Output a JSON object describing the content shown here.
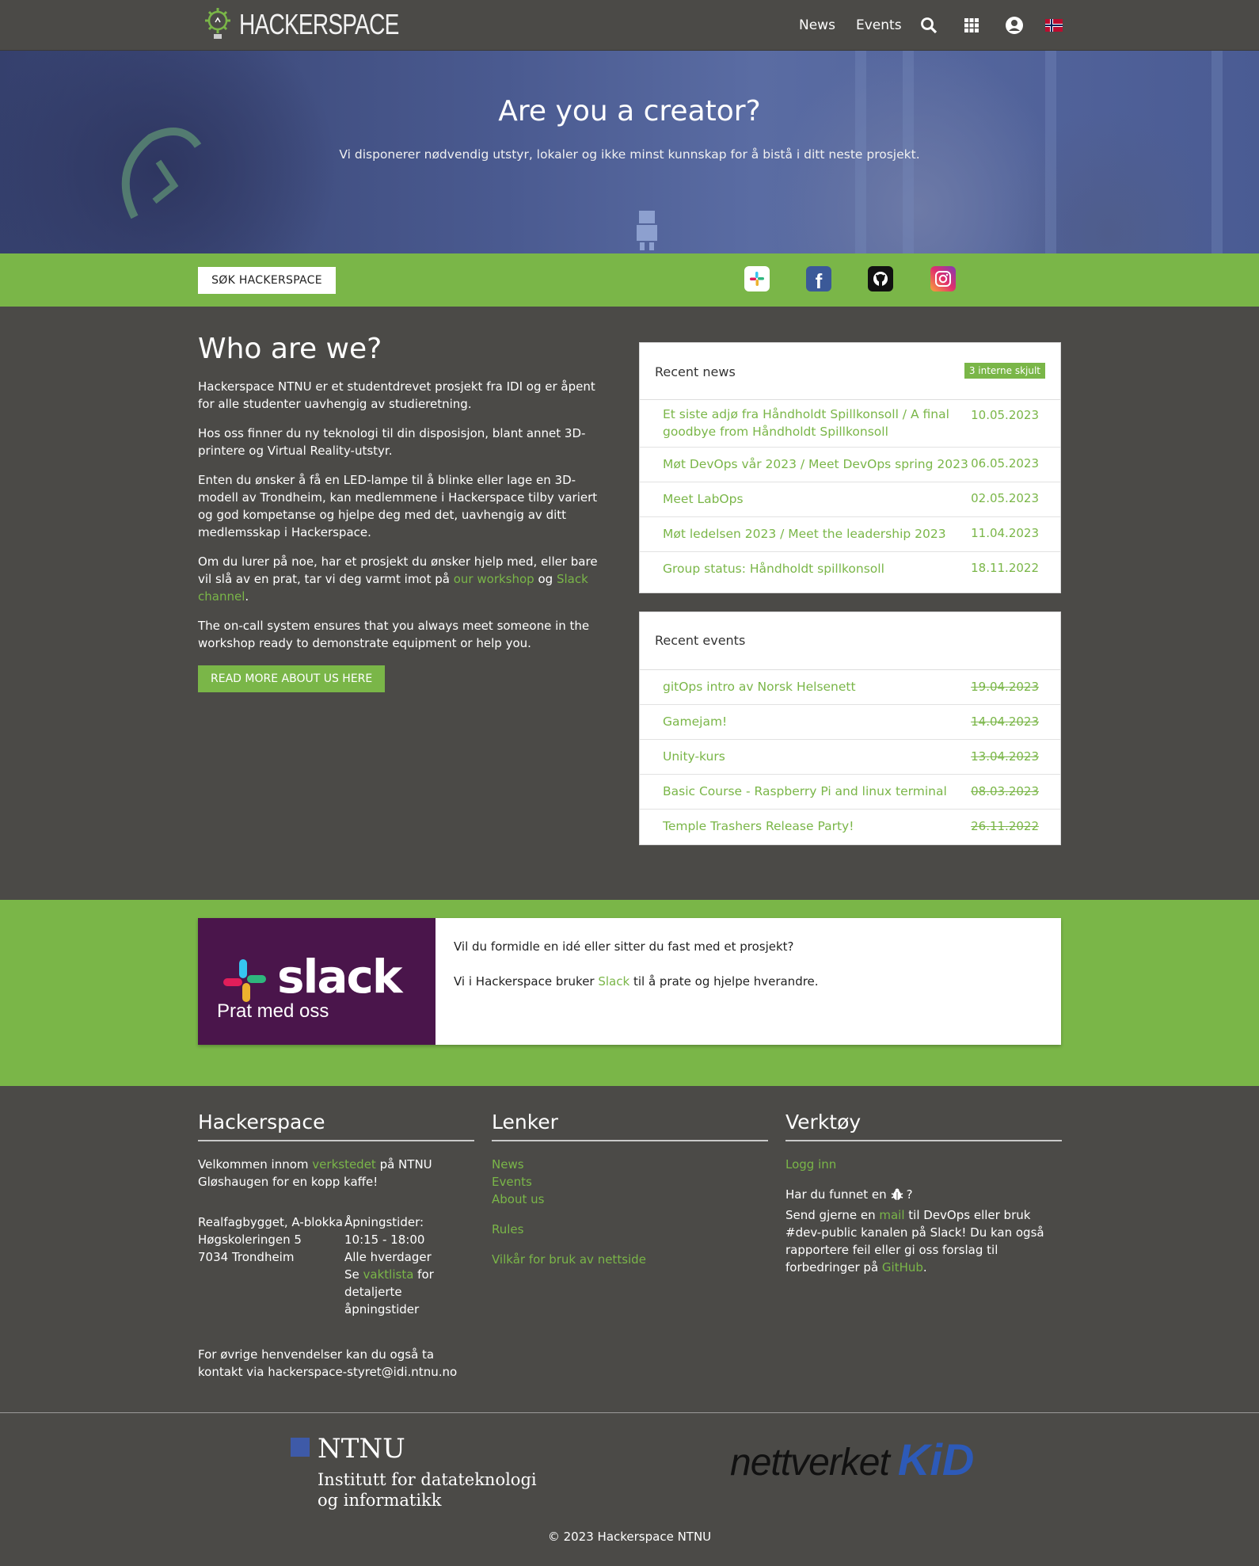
{
  "nav": {
    "brand": "HACKERSPACE",
    "links": [
      "News",
      "Events"
    ],
    "icons": [
      "search-icon",
      "apps-grid-icon",
      "account-icon",
      "norway-flag-icon"
    ]
  },
  "hero": {
    "title": "Are you a creator?",
    "subtitle": "Vi disponerer nødvendig utstyr, lokaler og ikke minst kunnskap for å bistå i ditt neste prosjekt."
  },
  "greenbar": {
    "search_label": "SØK HACKERSPACE",
    "social": [
      "slack-icon",
      "facebook-icon",
      "github-icon",
      "instagram-icon"
    ]
  },
  "about": {
    "title": "Who are we?",
    "p1": "Hackerspace NTNU er et studentdrevet prosjekt fra IDI og er åpent for alle studenter uavhengig av studieretning.",
    "p2": "Hos oss finner du ny teknologi til din disposisjon, blant annet 3D-printere og Virtual Reality-utstyr.",
    "p3": "Enten du ønsker å få en LED-lampe til å blinke eller lage en 3D-modell av Trondheim, kan medlemmene i Hackerspace tilby variert og god kompetanse og hjelpe deg med det, uavhengig av ditt medlemsskap i Hackerspace.",
    "p4_pre": "Om du lurer på noe, har et prosjekt du ønsker hjelp med, eller bare vil slå av en prat, tar vi deg varmt imot på ",
    "p4_link1": "our workshop",
    "p4_mid": " og ",
    "p4_link2": "Slack channel",
    "p4_post": ".",
    "p5": "The on-call system ensures that you always meet someone in the workshop ready to demonstrate equipment or help you.",
    "read_more": "READ MORE ABOUT US HERE"
  },
  "news": {
    "title": "Recent news",
    "badge": "3 interne skjult",
    "items": [
      {
        "title": "Et siste adjø fra Håndholdt Spillkonsoll / A final goodbye from Håndholdt Spillkonsoll",
        "date": "10.05.2023"
      },
      {
        "title": "Møt DevOps vår 2023 / Meet DevOps spring 2023",
        "date": "06.05.2023"
      },
      {
        "title": "Meet LabOps",
        "date": "02.05.2023"
      },
      {
        "title": "Møt ledelsen 2023 / Meet the leadership 2023",
        "date": "11.04.2023"
      },
      {
        "title": "Group status: Håndholdt spillkonsoll",
        "date": "18.11.2022"
      }
    ]
  },
  "events": {
    "title": "Recent events",
    "items": [
      {
        "title": "gitOps intro av Norsk Helsenett",
        "date": "19.04.2023"
      },
      {
        "title": "Gamejam!",
        "date": "14.04.2023"
      },
      {
        "title": "Unity-kurs",
        "date": "13.04.2023"
      },
      {
        "title": "Basic Course - Raspberry Pi and linux terminal",
        "date": "08.03.2023"
      },
      {
        "title": "Temple Trashers Release Party!",
        "date": "26.11.2022"
      }
    ]
  },
  "slack": {
    "logo_word": "slack",
    "logo_sub": "Prat med oss",
    "line1": "Vil du formidle en idé eller sitter du fast med et prosjekt?",
    "line2_pre": "Vi i Hackerspace bruker ",
    "line2_link": "Slack",
    "line2_post": " til å prate og hjelpe hverandre."
  },
  "footer": {
    "col1": {
      "title": "Hackerspace",
      "welcome_pre": "Velkommen innom ",
      "welcome_link": "verkstedet",
      "welcome_post": " på NTNU Gløshaugen for en kopp kaffe!",
      "address": [
        "Realfagbygget, A-blokka",
        "Høgskoleringen 5",
        "7034 Trondheim"
      ],
      "hours_label": "Åpningstider:",
      "hours": "10:15 - 18:00",
      "days": "Alle hverdager",
      "see_pre": "Se ",
      "see_link": "vaktlista",
      "see_post": " for detaljerte åpningstider",
      "contact": "For øvrige henvendelser kan du også ta kontakt via hackerspace-styret@idi.ntnu.no"
    },
    "col2": {
      "title": "Lenker",
      "links_a": [
        "News",
        "Events",
        "About us"
      ],
      "link_rules": "Rules",
      "link_terms": "Vilkår for bruk av nettside"
    },
    "col3": {
      "title": "Verktøy",
      "login": "Logg inn",
      "bug_pre": "Har du funnet en",
      "bug_post": "?",
      "report_pre": "Send gjerne en ",
      "report_link1": "mail",
      "report_mid": " til DevOps eller bruk #dev-public kanalen på Slack! Du kan også rapportere feil eller gi oss forslag til forbedringer på ",
      "report_link2": "GitHub",
      "report_post": "."
    },
    "ntnu_name": "NTNU",
    "ntnu_line1": "Institutt for datateknologi",
    "ntnu_line2": "og informatikk",
    "kid_word": "nettverket",
    "kid_mark": "KiD",
    "copyright": "© 2023 Hackerspace NTNU"
  },
  "colors": {
    "brand_green": "#7ab648",
    "background": "#4b4a47",
    "slack_purple": "#4a154b",
    "kid_blue": "#2d5ab8"
  }
}
